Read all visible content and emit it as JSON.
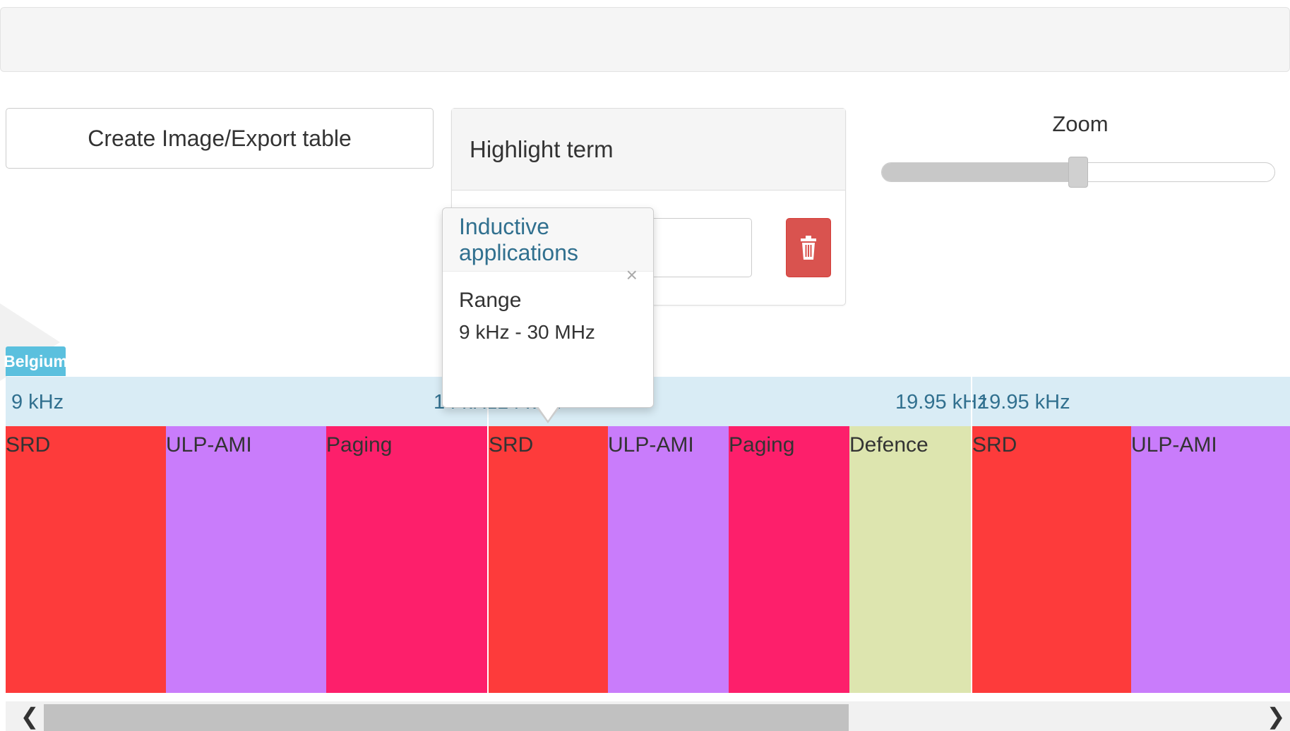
{
  "toolbar": {
    "export_label": "Create Image/Export table"
  },
  "highlight": {
    "title": "Highlight term",
    "input_value": ""
  },
  "zoom": {
    "label": "Zoom",
    "level": 0.5
  },
  "country": {
    "name": "Belgium"
  },
  "frequency_labels": {
    "segment1_start": "9 kHz",
    "segment1_end": "14 kHz",
    "segment2_start": "14 kHz",
    "segment2_end": "19.95 kHz",
    "segment3_start": "19.95 kHz"
  },
  "bands": [
    {
      "label": "SRD",
      "color": "#fd3b3b"
    },
    {
      "label": "ULP-AMI",
      "color": "#c97cfb"
    },
    {
      "label": "Paging",
      "color": "#fd1f6b"
    },
    {
      "label": "SRD",
      "color": "#fd3b3b"
    },
    {
      "label": "ULP-AMI",
      "color": "#c97cfb"
    },
    {
      "label": "Paging",
      "color": "#fd1f6b"
    },
    {
      "label": "Defence",
      "color": "#dde5af"
    },
    {
      "label": "SRD",
      "color": "#fd3b3b"
    },
    {
      "label": "ULP-AMI",
      "color": "#c97cfb"
    }
  ],
  "popover": {
    "title": "Inductive applications",
    "close_symbol": "×",
    "range_label": "Range",
    "range_value": "9 kHz - 30 MHz"
  },
  "scrollbar": {
    "left_arrow": "❮",
    "right_arrow": "❯"
  }
}
